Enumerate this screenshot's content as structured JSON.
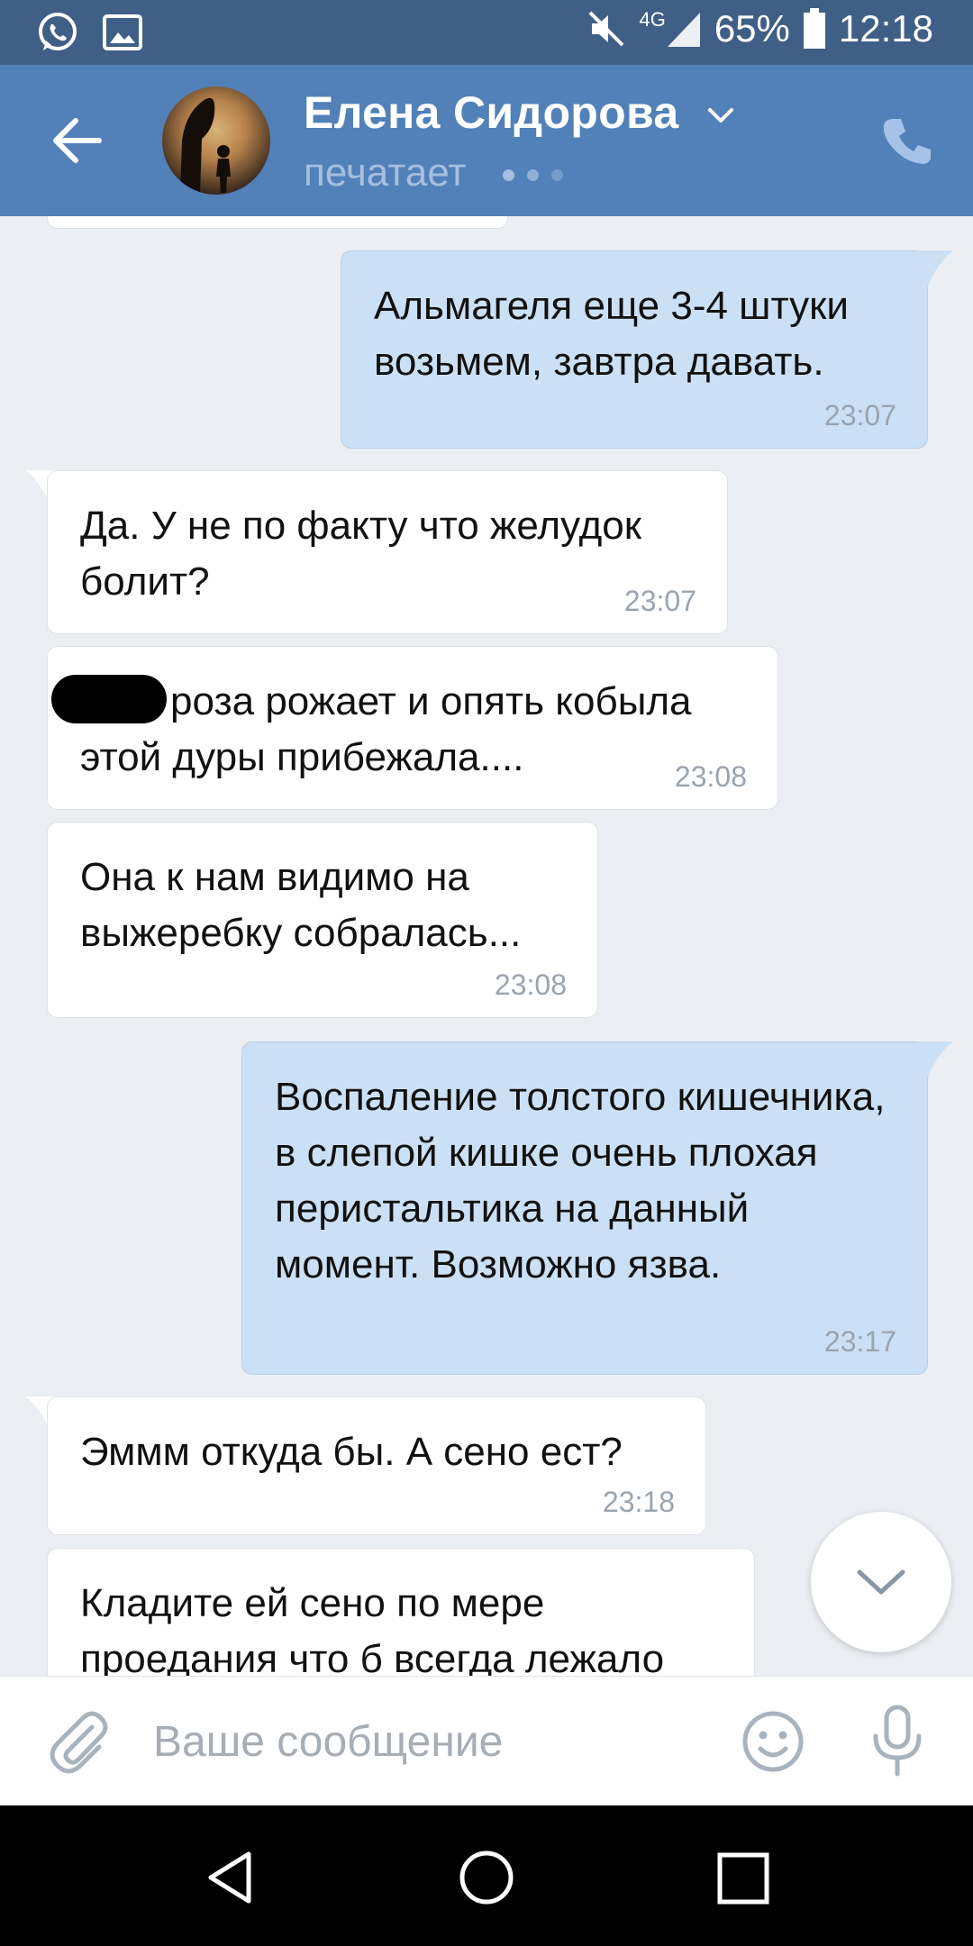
{
  "status_bar": {
    "network": "4G",
    "battery": "65%",
    "time": "12:18",
    "icons": [
      "whatsapp-icon",
      "gallery-icon",
      "mute-icon",
      "signal-icon",
      "battery-icon"
    ]
  },
  "header": {
    "contact_name": "Елена Сидорова",
    "status": "печатает"
  },
  "messages": [
    {
      "direction": "out",
      "text": "Альмагеля еще 3-4 штуки возьмем, завтра давать.",
      "time": "23:07"
    },
    {
      "direction": "in",
      "text": "Да. У не по факту что желудок болит?",
      "time": "23:07"
    },
    {
      "direction": "in",
      "text": "роза рожает и опять кобыла этой дуры прибежала....",
      "time": "23:08",
      "redacted_prefix": true
    },
    {
      "direction": "in",
      "text": "Она к нам видимо на выжеребку собралась...",
      "time": "23:08"
    },
    {
      "direction": "out",
      "text": "Воспаление толстого кишечника, в слепой кишке очень плохая перистальтика на данный момент. Возможно язва.",
      "time": "23:17"
    },
    {
      "direction": "in",
      "text": "Эммм откуда бы. А сено ест?",
      "time": "23:18"
    },
    {
      "direction": "in",
      "text": "Кладите ей сено по мере проедания что б всегда лежало",
      "time": ""
    }
  ],
  "composer": {
    "placeholder": "Ваше сообщение"
  },
  "colors": {
    "header": "#5181b8",
    "status_bar": "#3f5f87",
    "outgoing_bubble": "#cce0f5",
    "incoming_bubble": "#ffffff",
    "chat_background": "#ebeef2"
  }
}
